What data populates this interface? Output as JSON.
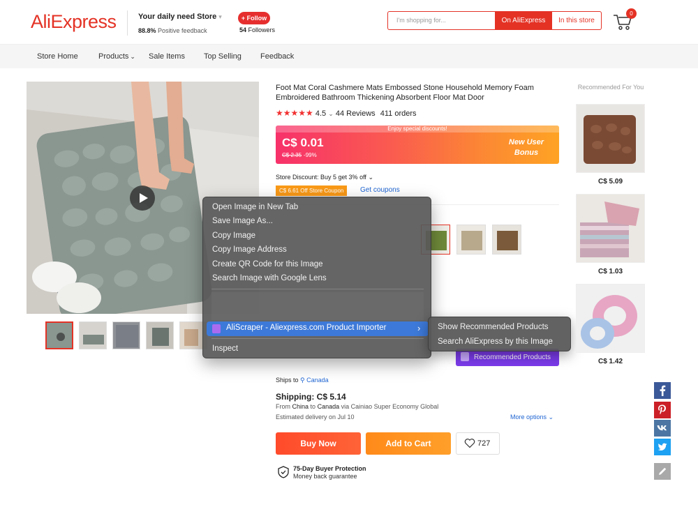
{
  "header": {
    "logo": "AliExpress",
    "store_name": "Your daily need Store",
    "feedback_pct": "88.8%",
    "feedback_label": "Positive feedback",
    "follow_label": "+ Follow",
    "followers_count": "54",
    "followers_label": "Followers",
    "search_placeholder": "I'm shopping for...",
    "btn_on_aliexpress": "On AliExpress",
    "btn_in_store": "In this store",
    "cart_count": "0"
  },
  "nav": {
    "items": [
      "Store Home",
      "Products",
      "Sale Items",
      "Top Selling",
      "Feedback"
    ]
  },
  "product": {
    "title": "Foot Mat Coral Cashmere Mats Embossed Stone Household Memory Foam Embroidered Bathroom Thickening Absorbent Floor Mat Door",
    "rating": "4.5",
    "reviews": "44 Reviews",
    "orders": "411 orders",
    "enjoy_text": "Enjoy special discounts!",
    "price": "C$ 0.01",
    "orig_price": "C$ 2.35",
    "discount": "-99%",
    "bonus_line1": "New User",
    "bonus_line2": "Bonus",
    "store_discount": "Store Discount: Buy 5 get 3% off",
    "coupon": "C$ 6.61 Off Store Coupon",
    "get_coupons": "Get coupons"
  },
  "context_menu": {
    "items": [
      "Open Image in New Tab",
      "Save Image As...",
      "Copy Image",
      "Copy Image Address",
      "Create QR Code for this Image",
      "Search Image with Google Lens"
    ],
    "extension": "AliScraper - Aliexpress.com Product Importer",
    "inspect": "Inspect",
    "submenu": [
      "Show Recommended Products",
      "Search AliExpress by this Image"
    ]
  },
  "recommended_btn": "Recommended Products",
  "shipping": {
    "ships_to_label": "Ships to",
    "ships_to_country": "Canada",
    "price": "Shipping: C$ 5.14",
    "from_prefix": "From",
    "from_country": "China",
    "to_word": "to",
    "to_country": "Canada",
    "via": "via Cainiao Super Economy Global",
    "delivery": "Estimated delivery on Jul 10",
    "more_options": "More options"
  },
  "actions": {
    "buy_now": "Buy Now",
    "add_to_cart": "Add to Cart",
    "wishlist_count": "727"
  },
  "protection": {
    "title": "75-Day Buyer Protection",
    "subtitle": "Money back guarantee"
  },
  "recommended": {
    "title": "Recommended For You",
    "prices": [
      "C$ 5.09",
      "C$ 1.03",
      "C$ 1.42"
    ]
  },
  "social": [
    "facebook-icon",
    "pinterest-icon",
    "vk-icon",
    "twitter-icon",
    "edit-icon"
  ],
  "colors": {
    "brand": "#e43225",
    "link": "#1e64d2",
    "highlight": "#3d79d8",
    "extension": "#7b3bea"
  }
}
